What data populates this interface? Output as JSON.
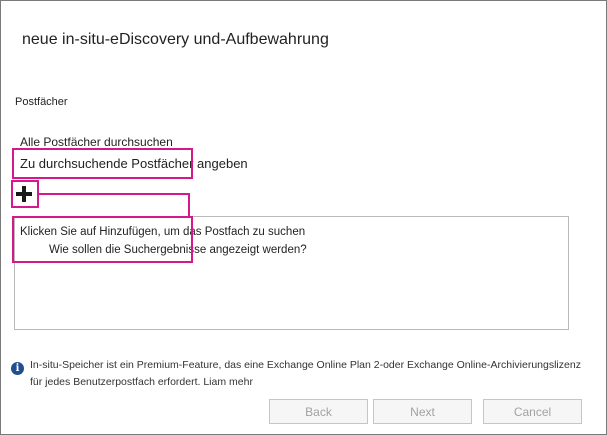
{
  "dialog": {
    "title": "neue in-situ-eDiscovery und-Aufbewahrung"
  },
  "mailboxes": {
    "section_label": "Postfächer",
    "option_all": "Alle Postfächer durchsuchen",
    "option_specify": "Zu durchsuchende Postfächer angeben",
    "add_icon": "plus-icon",
    "hint_add": "Klicken Sie auf Hinzufügen, um das Postfach zu suchen",
    "hint_results": "Wie sollen die Suchergebnisse angezeigt werden?"
  },
  "info": {
    "icon": "info-icon",
    "line1": "In-situ-Speicher ist ein Premium-Feature, das eine Exchange Online Plan 2-oder Exchange Online-Archivierungslizenz",
    "line2": "für jedes Benutzerpostfach erfordert. Liam mehr"
  },
  "buttons": {
    "back": "Back",
    "next": "Next",
    "cancel": "Cancel"
  },
  "colors": {
    "highlight": "#d6188c",
    "info_icon": "#1f4f8f"
  }
}
